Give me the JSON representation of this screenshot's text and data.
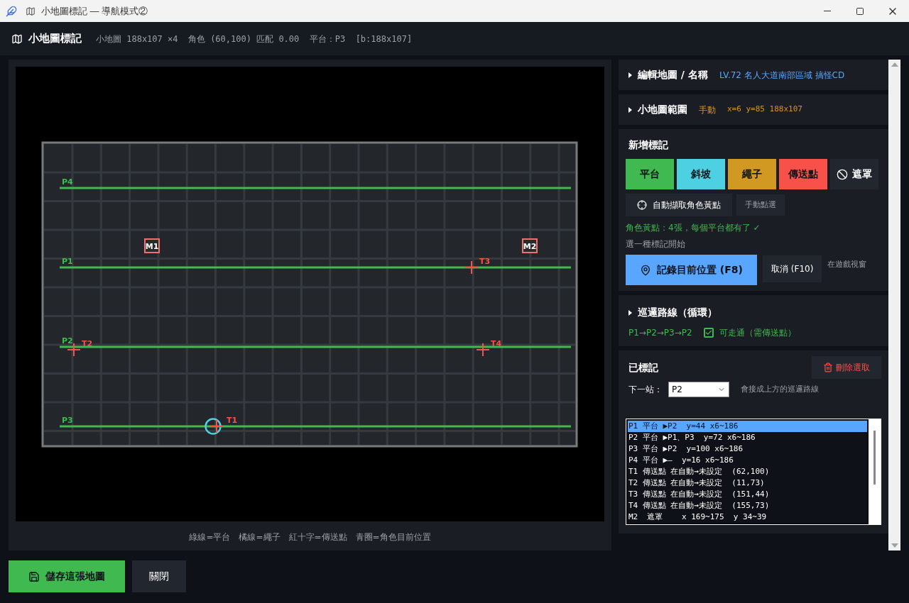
{
  "window": {
    "title": "小地圖標記 — 導航模式②"
  },
  "header": {
    "title": "小地圖標記",
    "info": "小地圖 188x107 ×4  角色 (60,100) 匹配 0.00  平台：P3  [b:188x107]"
  },
  "map": {
    "platforms": [
      {
        "label": "P4"
      },
      {
        "label": "P1"
      },
      {
        "label": "P2"
      },
      {
        "label": "P3"
      }
    ],
    "teleports": [
      {
        "label": "T1"
      },
      {
        "label": "T2"
      },
      {
        "label": "T3"
      },
      {
        "label": "T4"
      }
    ],
    "masks": [
      {
        "label": "M1"
      },
      {
        "label": "M2"
      }
    ],
    "legend": "綠線=平台　橘線=繩子　紅十字=傳送點　青圈=角色目前位置"
  },
  "sections": {
    "edit": {
      "title": "編輯地圖 / 名稱",
      "value": "LV.72 名人大道南部區域 搞怪CD",
      "expanded": false
    },
    "range": {
      "title": "小地圖範圍",
      "mode": "手動",
      "value": "x=6 y=85 188x107",
      "expanded": false
    },
    "add": {
      "title": "新增標記",
      "types": [
        {
          "label": "平台",
          "kind": "platform"
        },
        {
          "label": "斜坡",
          "kind": "slope"
        },
        {
          "label": "繩子",
          "kind": "rope"
        },
        {
          "label": "傳送點",
          "kind": "teleport"
        },
        {
          "label": "遮罩",
          "kind": "mask"
        }
      ],
      "auto_button": "自動擷取角色黃點",
      "manual_button": "手動點選",
      "status": "角色黃點：4張，每個平台都有了 ✓",
      "hint": "選一種標記開始",
      "record_button": "記錄目前位置 (F8)",
      "cancel_button": "取消 (F10)",
      "side_note": "在遊戲視窗"
    },
    "route": {
      "title": "巡邏路線（循環）",
      "path": "P1→P2→P3→P2",
      "walkable": {
        "checked": true,
        "label": "可走通（需傳送點）"
      },
      "expanded": false
    },
    "marked": {
      "title": "已標記",
      "delete_button": "刪除選取",
      "next_label": "下一站：",
      "next_value": "P2",
      "next_hint": "會接成上方的巡邏路線",
      "rows": [
        {
          "text": "P1 平台 ▶P2  y=44 x6~186",
          "selected": true
        },
        {
          "text": "P2 平台 ▶P1、P3  y=72 x6~186",
          "selected": false
        },
        {
          "text": "P3 平台 ▶P2  y=100 x6~186",
          "selected": false
        },
        {
          "text": "P4 平台 ▶–  y=16 x6~186",
          "selected": false
        },
        {
          "text": "T1 傳送點 在自動→未設定  (62,100)",
          "selected": false
        },
        {
          "text": "T2 傳送點 在自動→未設定  (11,73)",
          "selected": false
        },
        {
          "text": "T3 傳送點 在自動→未設定  (151,44)",
          "selected": false
        },
        {
          "text": "T4 傳送點 在自動→未設定  (155,73)",
          "selected": false
        },
        {
          "text": "M2  遮罩    x 169~175  y 34~39",
          "selected": false
        }
      ]
    }
  },
  "footer": {
    "save_button": "儲存這張地圖",
    "close_button": "關閉"
  }
}
